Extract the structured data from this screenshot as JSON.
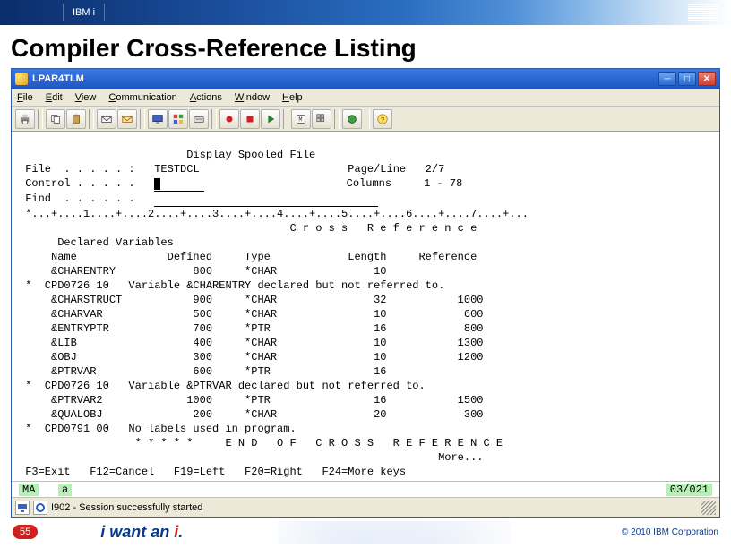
{
  "top": {
    "brand": "IBM i"
  },
  "slide_title": "Compiler Cross-Reference Listing",
  "tn": {
    "title": "LPAR4TLM",
    "menu": [
      {
        "u": "F",
        "rest": "ile"
      },
      {
        "u": "E",
        "rest": "dit"
      },
      {
        "u": "V",
        "rest": "iew"
      },
      {
        "u": "C",
        "rest": "ommunication"
      },
      {
        "u": "A",
        "rest": "ctions"
      },
      {
        "u": "W",
        "rest": "indow"
      },
      {
        "u": "H",
        "rest": "elp"
      }
    ],
    "header": "                          Display Spooled File",
    "file_label": " File  . . . . . :   ",
    "file_value": "TESTDCL",
    "page_label": "Page/Line",
    "page_value": "2/7",
    "control_label": " Control . . . . .   ",
    "col_label": "Columns",
    "col_value": "1 - 78",
    "find_label": " Find  . . . . . .   ",
    "ruler": " *...+....1....+....2....+....3....+....4....+....5....+....6....+....7....+...",
    "section_title": "                                          C r o s s   R e f e r e n c e",
    "decl_vars": "      Declared Variables",
    "col_hdr": "     Name              Defined     Type            Length     Reference",
    "rows": [
      "     &CHARENTRY            800     *CHAR               10",
      " *  CPD0726 10   Variable &CHARENTRY declared but not referred to.",
      "     &CHARSTRUCT           900     *CHAR               32           1000",
      "     &CHARVAR              500     *CHAR               10            600",
      "     &ENTRYPTR             700     *PTR                16            800",
      "     &LIB                  400     *CHAR               10           1300",
      "     &OBJ                  300     *CHAR               10           1200",
      "     &PTRVAR               600     *PTR                16",
      " *  CPD0726 10   Variable &PTRVAR declared but not referred to.",
      "     &PTRVAR2             1000     *PTR                16           1500",
      "     &QUALOBJ              200     *CHAR               20            300",
      " *  CPD0791 00   No labels used in program.",
      "                  * * * * *     E N D   O F   C R O S S   R E F E R E N C E",
      "                                                                 More..."
    ],
    "fkeys": " F3=Exit   F12=Cancel   F19=Left   F20=Right   F24=More keys",
    "oia_left": "MA",
    "oia_a": "a",
    "oia_coord": "03/021",
    "status": "I902 - Session successfully started"
  },
  "footer": {
    "page": "55",
    "slogan_pre": "i want an ",
    "slogan_i": "i",
    "slogan_post": ".",
    "copy": "© 2010 IBM Corporation"
  }
}
